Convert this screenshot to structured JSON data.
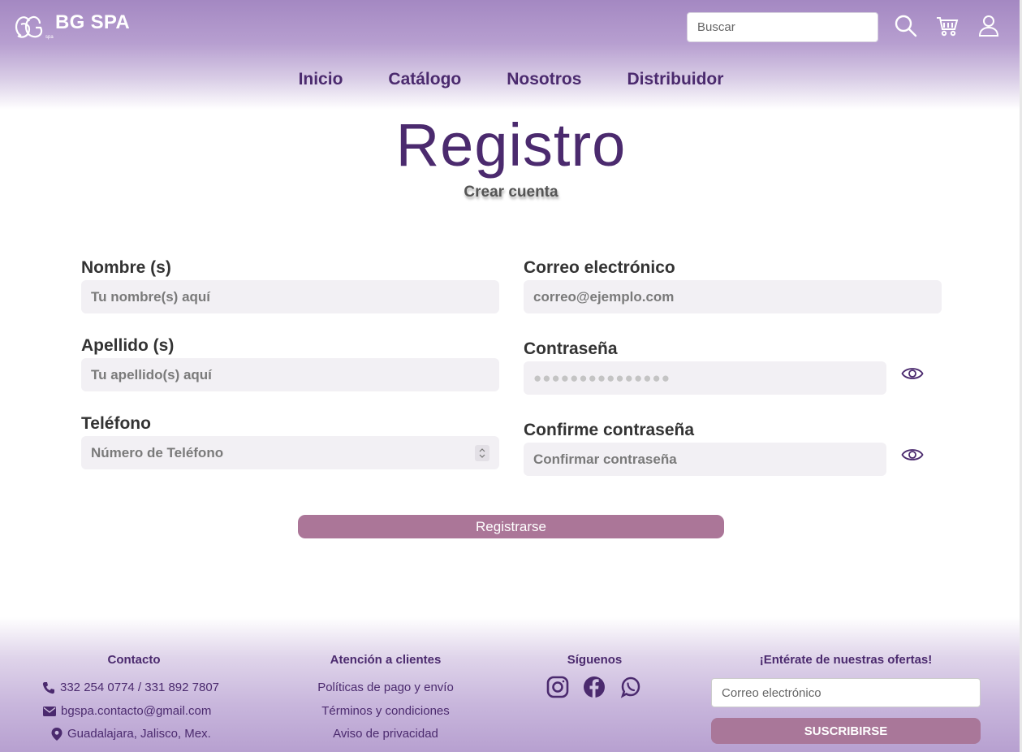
{
  "header": {
    "brand": "BG SPA",
    "search_placeholder": "Buscar",
    "icons": [
      "search-icon",
      "cart-icon",
      "user-icon"
    ],
    "nav": [
      "Inicio",
      "Catálogo",
      "Nosotros",
      "Distribuidor"
    ]
  },
  "page": {
    "title": "Registro",
    "subtitle": "Crear cuenta"
  },
  "form": {
    "name_label": "Nombre (s)",
    "name_placeholder": "Tu nombre(s) aquí",
    "lastname_label": "Apellido (s)",
    "lastname_placeholder": "Tu apellido(s) aquí",
    "phone_label": "Teléfono",
    "phone_placeholder": "Número de Teléfono",
    "email_label": "Correo electrónico",
    "email_placeholder": "correo@ejemplo.com",
    "password_label": "Contraseña",
    "password_mask": "●●●●●●●●●●●●●●●",
    "confirm_label": "Confirme contraseña",
    "confirm_placeholder": "Confirmar contraseña",
    "submit_label": "Registrarse"
  },
  "footer": {
    "contact": {
      "title": "Contacto",
      "phone": "332 254 0774 / 331 892 7807",
      "email": "bgspa.contacto@gmail.com",
      "location": "Guadalajara, Jalisco, Mex."
    },
    "support": {
      "title": "Atención a clientes",
      "links": [
        "Políticas de pago y envío",
        "Términos y condiciones",
        "Aviso de privacidad"
      ]
    },
    "social": {
      "title": "Síguenos",
      "icons": [
        "instagram-icon",
        "facebook-icon",
        "whatsapp-icon"
      ]
    },
    "newsletter": {
      "title": "¡Entérate de nuestras ofertas!",
      "placeholder": "Correo electrónico",
      "button": "SUSCRIBIRSE"
    }
  },
  "colors": {
    "header_purple": "#a488c2",
    "title_purple": "#4b2a6e",
    "button_mauve": "#ab7698"
  }
}
